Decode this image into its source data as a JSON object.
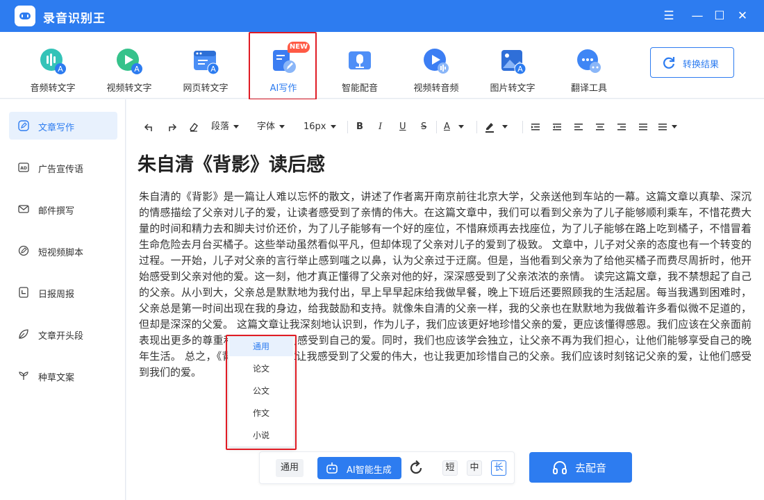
{
  "app": {
    "title": "录音识别王"
  },
  "window_controls": {
    "menu": "☰",
    "minimize": "—",
    "maximize": "☐",
    "close": "✕"
  },
  "toolbar": {
    "items": [
      {
        "label": "音频转文字",
        "icon": "audio-to-text-icon"
      },
      {
        "label": "视频转文字",
        "icon": "video-to-text-icon"
      },
      {
        "label": "网页转文字",
        "icon": "webpage-to-text-icon"
      },
      {
        "label": "AI写作",
        "icon": "ai-writing-icon",
        "badge": "NEW"
      },
      {
        "label": "智能配音",
        "icon": "smart-dubbing-icon"
      },
      {
        "label": "视频转音频",
        "icon": "video-to-audio-icon"
      },
      {
        "label": "图片转文字",
        "icon": "image-to-text-icon"
      },
      {
        "label": "翻译工具",
        "icon": "translate-icon"
      }
    ],
    "convert_result": "转换结果"
  },
  "sidebar": {
    "items": [
      {
        "label": "文章写作",
        "icon": "edit-icon"
      },
      {
        "label": "广告宣传语",
        "icon": "ad-icon"
      },
      {
        "label": "邮件撰写",
        "icon": "mail-icon"
      },
      {
        "label": "短视频脚本",
        "icon": "script-icon"
      },
      {
        "label": "日报周报",
        "icon": "report-icon"
      },
      {
        "label": "文章开头段",
        "icon": "leaf-icon"
      },
      {
        "label": "种草文案",
        "icon": "sprout-icon"
      }
    ]
  },
  "format_bar": {
    "paragraph": "段落",
    "font": "字体",
    "font_size": "16px",
    "bold": "B",
    "italic": "I",
    "underline": "U",
    "strike": "S",
    "font_color": "A"
  },
  "document": {
    "title": "朱自清《背影》读后感",
    "body": "朱自清的《背影》是一篇让人难以忘怀的散文，讲述了作者离开南京前往北京大学，父亲送他到车站的一幕。这篇文章以真挚、深沉的情感描绘了父亲对儿子的爱，让读者感受到了亲情的伟大。在这篇文章中，我们可以看到父亲为了儿子能够顺利乘车，不惜花费大量的时间和精力去和脚夫讨价还价，为了儿子能够有一个好的座位，不惜麻烦再去找座位，为了儿子能够在路上吃到橘子，不惜冒着生命危险去月台买橘子。这些举动虽然看似平凡，但却体现了父亲对儿子的爱到了极致。 文章中，儿子对父亲的态度也有一个转变的过程。一开始，儿子对父亲的言行举止感到嗤之以鼻，认为父亲过于迂腐。但是，当他看到父亲为了给他买橘子而费尽周折时，他开始感受到父亲对他的爱。这一刻，他才真正懂得了父亲对他的好，深深感受到了父亲浓浓的亲情。 读完这篇文章，我不禁想起了自己的父亲。从小到大，父亲总是默默地为我付出，早上早早起床给我做早餐，晚上下班后还要照顾我的生活起居。每当我遇到困难时，父亲总是第一时间出现在我的身边，给我鼓励和支持。就像朱自清的父亲一样，我的父亲也在默默地为我做着许多看似微不足道的，但却是深深的父爱。 这篇文章让我深刻地认识到，作为儿子，我们应该更好地珍惜父亲的爱，更应该懂得感恩。我们应该在父亲面前表现出更多的尊重和关心，让他们感受到自己的爱。同时，我们也应该学会独立，让父亲不再为我们担心，让他们能够享受自己的晚年生活。 总之，《背影》这篇文章让我感受到了父爱的伟大，也让我更加珍惜自己的父亲。我们应该时刻铭记父亲的爱，让他们感受到我们的爱。"
  },
  "dropdown": {
    "options": [
      "通用",
      "论文",
      "公文",
      "作文",
      "小说"
    ],
    "selected": "通用"
  },
  "bottom": {
    "style": "通用",
    "generate": "AI智能生成",
    "lengths": [
      "短",
      "中",
      "长"
    ],
    "selected_length": "长",
    "dub": "去配音"
  },
  "colors": {
    "accent": "#2d7cf0",
    "highlight": "#e01b24",
    "badge": "#ff5a45"
  }
}
